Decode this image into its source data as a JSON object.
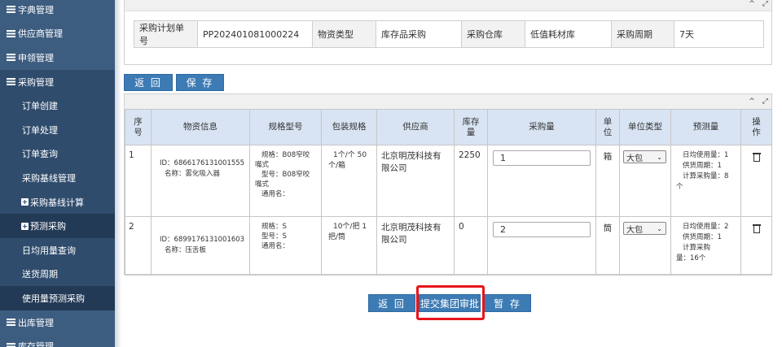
{
  "sidebar": {
    "items": [
      {
        "label": "字典管理",
        "type": "top"
      },
      {
        "label": "供应商管理",
        "type": "top"
      },
      {
        "label": "申领管理",
        "type": "top"
      },
      {
        "label": "采购管理",
        "type": "top-active"
      },
      {
        "label": "订单创建",
        "type": "sub"
      },
      {
        "label": "订单处理",
        "type": "sub"
      },
      {
        "label": "订单查询",
        "type": "sub"
      },
      {
        "label": "采购基线管理",
        "type": "sub"
      },
      {
        "label": "采购基线计算",
        "type": "group"
      },
      {
        "label": "预测采购",
        "type": "group-hl"
      },
      {
        "label": "日均用量查询",
        "type": "sub"
      },
      {
        "label": "送货周期",
        "type": "sub"
      },
      {
        "label": "使用量预测采购",
        "type": "sub-hl"
      },
      {
        "label": "出库管理",
        "type": "top"
      },
      {
        "label": "库存管理",
        "type": "top"
      }
    ]
  },
  "info": {
    "plan_no_label": "采购计划单号",
    "plan_no": "PP202401081000224",
    "type_label": "物资类型",
    "type_value": "库存品采购",
    "warehouse_label": "采购仓库",
    "warehouse_value": "低值耗材库",
    "period_label": "采购周期",
    "period_value": "7天"
  },
  "buttons": {
    "back": "返 回",
    "save": "保 存",
    "back_bottom": "返 回",
    "submit": "提交集团审批",
    "draft": "暂 存"
  },
  "panel_tools": {
    "collapse": "^",
    "expand": "⤢"
  },
  "table": {
    "headers": [
      "序号",
      "物资信息",
      "规格型号",
      "包装规格",
      "供应商",
      "库存量",
      "采购量",
      "单位",
      "单位类型",
      "预测量",
      "操作"
    ],
    "rows": [
      {
        "no": "1",
        "id_line": "ID：6866176131001555",
        "name_line": "名称：雾化吸入器",
        "spec_l1": "规格：B08窄咬",
        "spec_l2": "嘴式",
        "spec_l3": "型号：B08窄咬",
        "spec_l4": "嘴式",
        "spec_l5": "通用名：",
        "pack_l1": "1个/个 50",
        "pack_l2": "个/箱",
        "supplier_l1": "北京明茂科技有",
        "supplier_l2": "限公司",
        "stock": "2250",
        "qty": "1",
        "unit": "箱",
        "unit_type": "大包",
        "pred_l1": "日均使用量：1",
        "pred_l2": "供货周期：1",
        "pred_l3": "计算采购量：8",
        "pred_l4": "个"
      },
      {
        "no": "2",
        "id_line": "ID：6899176131001603",
        "name_line": "名称：压舌板",
        "spec_l1": "规格：S",
        "spec_l2": "",
        "spec_l3": "型号：S",
        "spec_l4": "",
        "spec_l5": "通用名：",
        "pack_l1": "10个/把 1",
        "pack_l2": "把/筒",
        "supplier_l1": "北京明茂科技有",
        "supplier_l2": "限公司",
        "stock": "0",
        "qty": "2",
        "unit": "筒",
        "unit_type": "大包",
        "pred_l1": "日均使用量：2",
        "pred_l2": "供货周期：1",
        "pred_l3": "计算采购",
        "pred_l4": "量：16个"
      }
    ]
  }
}
